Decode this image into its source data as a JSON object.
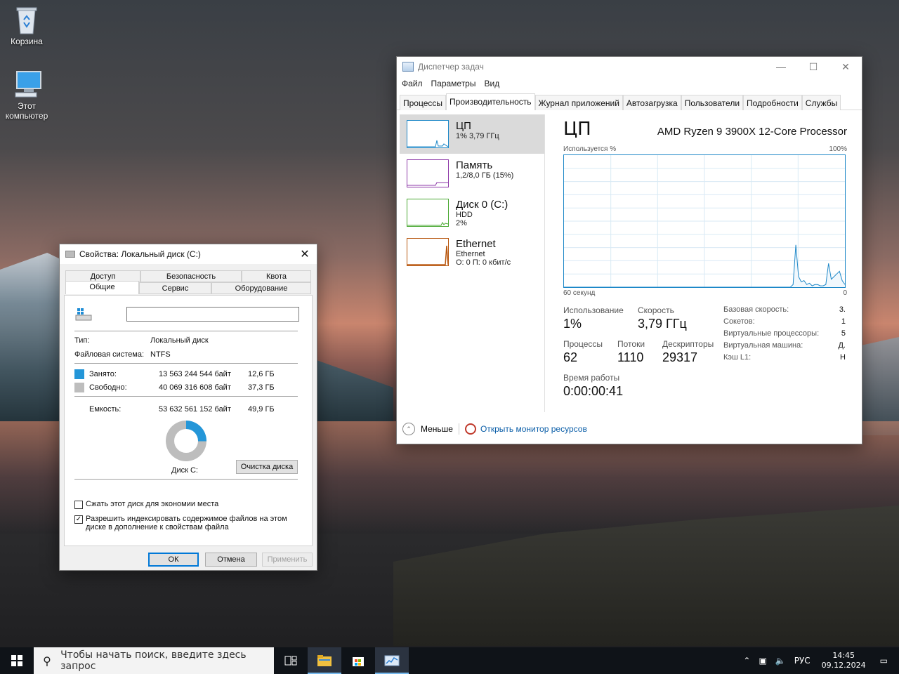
{
  "desktop": {
    "icons": [
      {
        "label": "Корзина"
      },
      {
        "label": "Этот компьютер"
      }
    ]
  },
  "taskmgr": {
    "title": "Диспетчер задач",
    "menu": [
      "Файл",
      "Параметры",
      "Вид"
    ],
    "tabs": [
      "Процессы",
      "Производительность",
      "Журнал приложений",
      "Автозагрузка",
      "Пользователи",
      "Подробности",
      "Службы"
    ],
    "active_tab": "Производительность",
    "sidebar": [
      {
        "title": "ЦП",
        "line1": "1% 3,79 ГГц",
        "line2": "",
        "color": "#1e88c8"
      },
      {
        "title": "Память",
        "line1": "1,2/8,0 ГБ (15%)",
        "line2": "",
        "color": "#8e3aa8"
      },
      {
        "title": "Диск 0 (C:)",
        "line1": "HDD",
        "line2": "2%",
        "color": "#4aa832"
      },
      {
        "title": "Ethernet",
        "line1": "Ethernet",
        "line2": "О: 0 П: 0 кбит/с",
        "color": "#b8570f"
      }
    ],
    "cpu": {
      "heading": "ЦП",
      "processor": "AMD Ryzen 9 3900X 12-Core Processor",
      "usage_label": "Используется %",
      "max_label": "100%",
      "time_label": "60 секунд",
      "min_label": "0",
      "graph_values": [
        0,
        0,
        0,
        0,
        0,
        0,
        0,
        0,
        0,
        0,
        0,
        0,
        0,
        0,
        0,
        0,
        0,
        0,
        0,
        0,
        0,
        0,
        0,
        0,
        0,
        0,
        0,
        0,
        0,
        0,
        0,
        0,
        0,
        0,
        0,
        0,
        0,
        0,
        0,
        0,
        0,
        0,
        0,
        0,
        0,
        0,
        0,
        0,
        0,
        0,
        0,
        0,
        0,
        0,
        0,
        0,
        0,
        0,
        0,
        0,
        0,
        0,
        0,
        0,
        0,
        0,
        0,
        0,
        0,
        0,
        0,
        0,
        0,
        0,
        0,
        0,
        0,
        0,
        0,
        0,
        0,
        0,
        0,
        0,
        2,
        32,
        8,
        4,
        5,
        2,
        3,
        1,
        2,
        2,
        1,
        1,
        2,
        18,
        6,
        8,
        10,
        12,
        5,
        2
      ],
      "usage_title": "Использование",
      "usage": "1%",
      "speed_title": "Скорость",
      "speed": "3,79 ГГц",
      "proc_title": "Процессы",
      "proc": "62",
      "threads_title": "Потоки",
      "threads": "1110",
      "handles_title": "Дескрипторы",
      "handles": "29317",
      "uptime_title": "Время работы",
      "uptime": "0:00:00:41",
      "info": [
        {
          "k": "Базовая скорость:",
          "v": "3."
        },
        {
          "k": "Сокетов:",
          "v": "1"
        },
        {
          "k": "Виртуальные процессоры:",
          "v": "5"
        },
        {
          "k": "Виртуальная машина:",
          "v": "Д."
        },
        {
          "k": "Кэш L1:",
          "v": "Н"
        }
      ]
    },
    "footer": {
      "less": "Меньше",
      "monitor": "Открыть монитор ресурсов"
    }
  },
  "props": {
    "title": "Свойства: Локальный диск (C:)",
    "tabs_top": [
      "Доступ",
      "Безопасность",
      "Квота"
    ],
    "tabs_bottom": [
      "Общие",
      "Сервис",
      "Оборудование"
    ],
    "name_value": "",
    "type_label": "Тип:",
    "type_value": "Локальный диск",
    "fs_label": "Файловая система:",
    "fs_value": "NTFS",
    "used_label": "Занято:",
    "used_bytes": "13 563 244 544 байт",
    "used_gb": "12,6 ГБ",
    "used_color": "#2496d8",
    "free_label": "Свободно:",
    "free_bytes": "40 069 316 608 байт",
    "free_gb": "37,3 ГБ",
    "free_color": "#bdbdbd",
    "cap_label": "Емкость:",
    "cap_bytes": "53 632 561 152 байт",
    "cap_gb": "49,9 ГБ",
    "disk_label": "Диск C:",
    "cleanup": "Очистка диска",
    "compress": "Сжать этот диск для экономии места",
    "compress_checked": false,
    "index": "Разрешить индексировать содержимое файлов на этом диске в дополнение к свойствам файла",
    "index_checked": true,
    "ok": "ОК",
    "cancel": "Отмена",
    "apply": "Применить"
  },
  "taskbar": {
    "search_placeholder": "Чтобы начать поиск, введите здесь запрос",
    "lang": "РУС",
    "time": "14:45",
    "date": "09.12.2024"
  }
}
